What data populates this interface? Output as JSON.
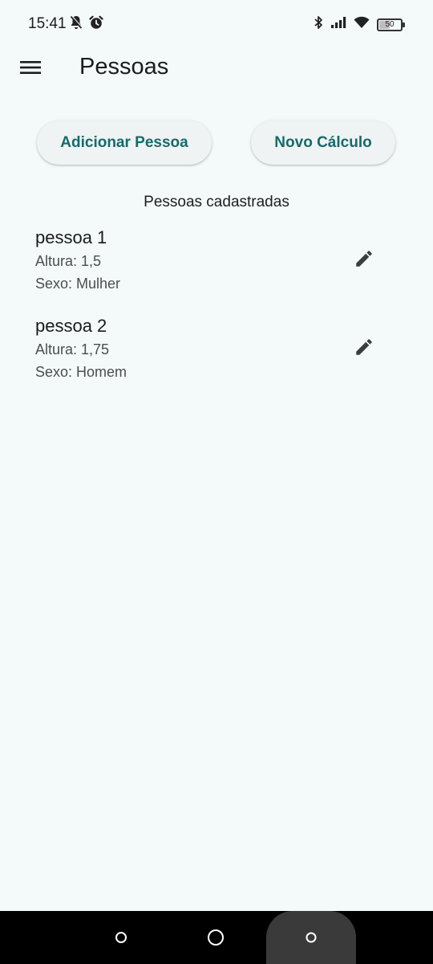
{
  "status_bar": {
    "time": "15:41",
    "battery_level": "50",
    "icons": [
      "mute-icon",
      "alarm-icon",
      "bluetooth-icon",
      "signal-icon",
      "wifi-icon",
      "battery-icon"
    ]
  },
  "app_bar": {
    "title": "Pessoas",
    "menu_icon": "hamburger-menu-icon"
  },
  "actions": {
    "add_person_label": "Adicionar Pessoa",
    "new_calc_label": "Novo Cálculo"
  },
  "list_title": "Pessoas cadastradas",
  "people": [
    {
      "name": "pessoa 1",
      "height": "Altura: 1,5",
      "sex": "Sexo: Mulher"
    },
    {
      "name": "pessoa 2",
      "height": "Altura: 1,75",
      "sex": "Sexo: Homem"
    }
  ],
  "colors": {
    "background": "#f4f9f9",
    "accent": "#156b6b",
    "button_bg": "#f0f3f3",
    "nav_bar": "#000000"
  },
  "nav_bar": {
    "icons": [
      "back-circle-icon",
      "home-circle-icon",
      "recents-circle-icon"
    ]
  }
}
